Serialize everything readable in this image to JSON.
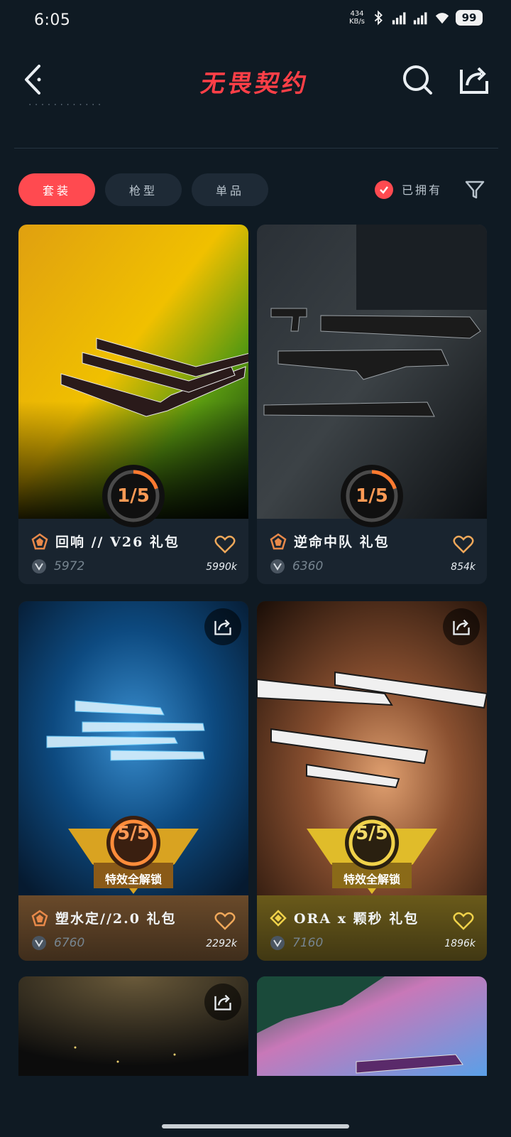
{
  "status_bar": {
    "time": "6:05",
    "net_speed_value": "434",
    "net_speed_unit": "KB/s",
    "battery": "99"
  },
  "header": {
    "app_title": "无畏契约",
    "faded_subtext": "·  ·  ·  ·  ·  ·  ·  ·  ·  ·  ·  ·"
  },
  "filters": {
    "tabs": [
      {
        "label": "套装",
        "active": true
      },
      {
        "label": "枪型",
        "active": false
      },
      {
        "label": "单品",
        "active": false
      }
    ],
    "owned_label": "已拥有"
  },
  "cards": [
    {
      "title": "回响 // V26 礼包",
      "vp": "5972",
      "likes": "5990k",
      "progress": "1/5",
      "progress_fraction": 0.2,
      "tier_color": "#e8894a"
    },
    {
      "title": "逆命中队 礼包",
      "vp": "6360",
      "likes": "854k",
      "progress": "1/5",
      "progress_fraction": 0.2,
      "tier_color": "#e8894a"
    },
    {
      "title": "塑水定//2.0 礼包",
      "vp": "6760",
      "likes": "2292k",
      "progress": "5/5",
      "progress_fraction": 1.0,
      "unlock_text": "特效全解锁",
      "tier_color": "#e8894a"
    },
    {
      "title": "ORA x 颗秒 礼包",
      "vp": "7160",
      "likes": "1896k",
      "progress": "5/5",
      "progress_fraction": 1.0,
      "unlock_text": "特效全解锁",
      "tier_color": "#f0d24a"
    }
  ],
  "colors": {
    "accent": "#ff4a50",
    "background": "#0f1a23",
    "card": "#19242f"
  }
}
